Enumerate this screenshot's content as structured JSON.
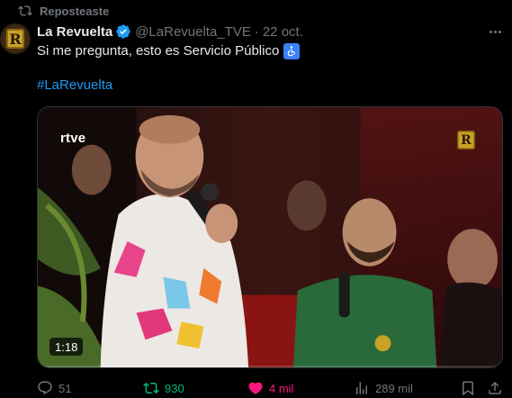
{
  "repost": {
    "label": "Reposteaste",
    "icon": "repost-icon"
  },
  "author": {
    "name": "La Revuelta",
    "handle": "@LaRevuelta_TVE",
    "date": "22 oct.",
    "avatar_text": "R",
    "verified_icon": "verified-badge-icon"
  },
  "post": {
    "text": "Si me pregunta, esto es Servicio Público",
    "emoji": "wheelchair-symbol-icon",
    "hashtag": "#LaRevuelta"
  },
  "media": {
    "broadcaster": "rtve",
    "channel_logo_text": "R",
    "duration": "1:18",
    "progress": 0.0
  },
  "actions": {
    "replies": "51",
    "reposts": "930",
    "likes": "4 mil",
    "views": "289 mil"
  },
  "colors": {
    "accent_blue": "#1d9bf0",
    "repost_green": "#00ba7c",
    "like_pink": "#f91880",
    "muted": "#71767b"
  }
}
